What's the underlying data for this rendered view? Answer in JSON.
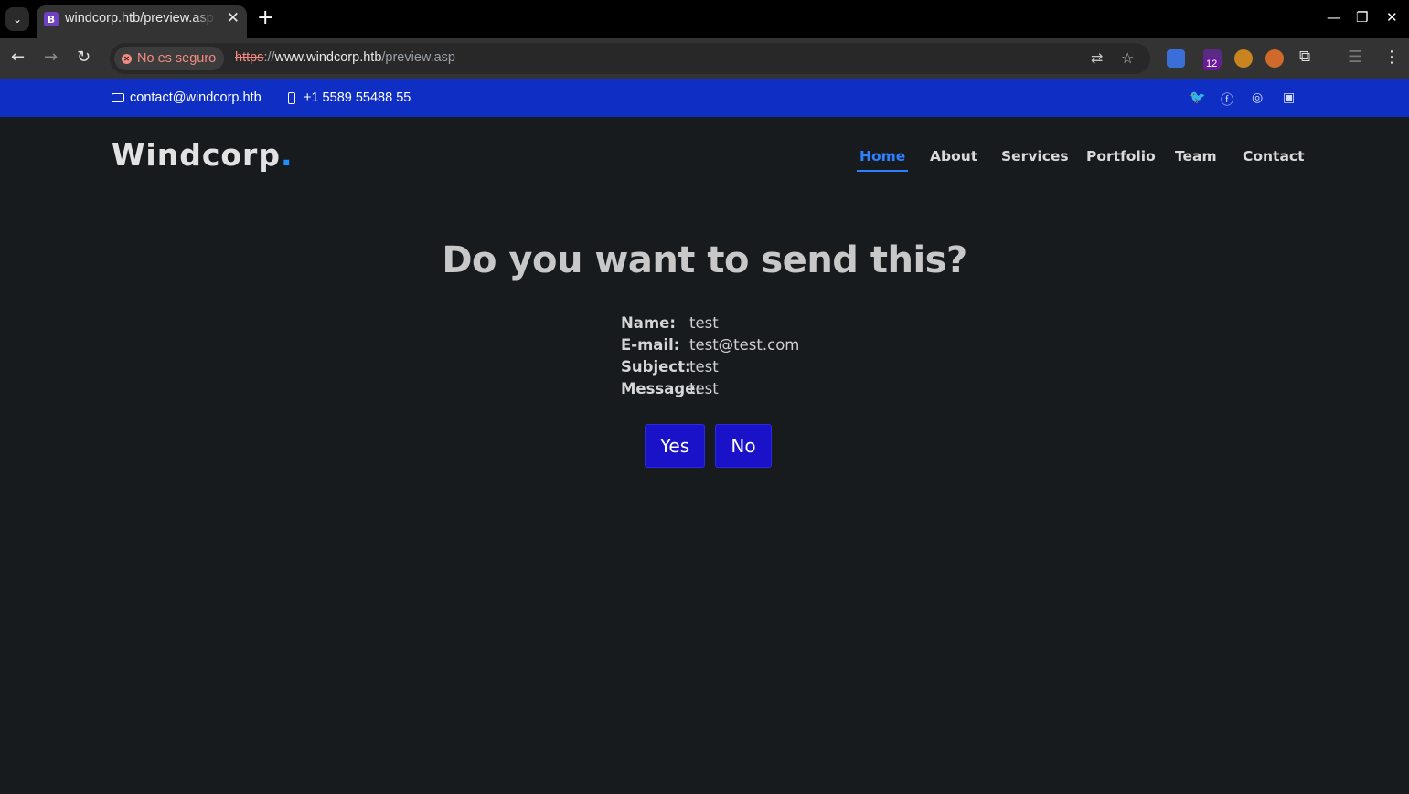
{
  "browser": {
    "tab_favicon": "B",
    "tab_title": "windcorp.htb/preview.asp",
    "security_label": "No es seguro",
    "url_scheme": "https",
    "url_sep": "://",
    "url_host": "www.windcorp.htb",
    "url_path": "/preview.asp",
    "extension_badge": "12"
  },
  "topbar": {
    "email": "contact@windcorp.htb",
    "phone": "+1 5589 55488 55"
  },
  "header": {
    "logo_text": "Windcorp",
    "logo_dot": ".",
    "nav": [
      "Home",
      "About",
      "Services",
      "Portfolio",
      "Team",
      "Contact"
    ]
  },
  "main": {
    "title": "Do you want to send this?",
    "fields": [
      {
        "label": "Name:",
        "value": "test"
      },
      {
        "label": "E-mail:",
        "value": "test@test.com"
      },
      {
        "label": "Subject:",
        "value": "test"
      },
      {
        "label": "Message:",
        "value": "test"
      }
    ],
    "yes_label": "Yes",
    "no_label": "No"
  },
  "colors": {
    "topbar_bg": "#0f2fc4",
    "page_bg": "#171b1e",
    "accent": "#2f80ff",
    "button_bg": "#1a12c8"
  }
}
